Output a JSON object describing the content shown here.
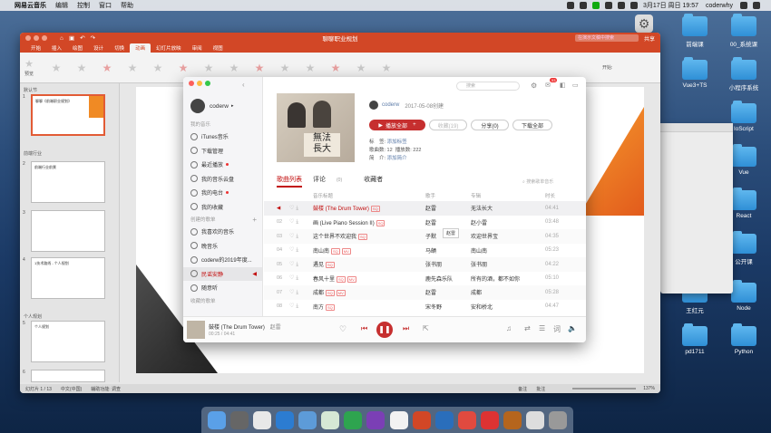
{
  "menubar": {
    "app": "网易云音乐",
    "items": [
      "编辑",
      "控制",
      "窗口",
      "帮助"
    ],
    "clock": "3月17日 周日 19:57",
    "user": "coderwhy"
  },
  "desktop_icons": [
    {
      "label": "前端课",
      "col": 0,
      "row": 0
    },
    {
      "label": "00_系统课",
      "col": 1,
      "row": 0
    },
    {
      "label": "Vue3+TS",
      "col": 0,
      "row": 1
    },
    {
      "label": "小程序系统",
      "col": 1,
      "row": 1
    },
    {
      "label": "loScript",
      "col": 1,
      "row": 2
    },
    {
      "label": "Vue",
      "col": 1,
      "row": 3
    },
    {
      "label": "React",
      "col": 1,
      "row": 4
    },
    {
      "label": "公开课",
      "col": 1,
      "row": 5
    },
    {
      "label": "Node",
      "col": 1,
      "row": 6
    },
    {
      "label": "Python",
      "col": 1,
      "row": 7
    },
    {
      "label": "王红元",
      "col": 0,
      "row": 6
    },
    {
      "label": "pd1711",
      "col": 0,
      "row": 7
    }
  ],
  "ppt": {
    "doc_title": "聊聊职业规划",
    "search_placeholder": "在演示文稿中搜索",
    "share_label": "共享",
    "tabs": [
      "开始",
      "插入",
      "绘图",
      "设计",
      "切换",
      "动画",
      "幻灯片放映",
      "审阅",
      "视图"
    ],
    "active_tab": "动画",
    "ribbon_preview": "预览",
    "ribbon_start": "开始:",
    "sections": [
      "默认节",
      "前端行业",
      "个人规划"
    ],
    "slides": [
      {
        "num": "1",
        "title": "聊聊《前端职业规划》"
      },
      {
        "num": "2",
        "title": "前端行业前景"
      },
      {
        "num": "3",
        "title": ""
      },
      {
        "num": "4",
        "title": "1技术路线 - 个人规划"
      },
      {
        "num": "5",
        "title": "个人规划"
      },
      {
        "num": "6",
        "title": ""
      }
    ],
    "status_slide": "幻灯片 1 / 13",
    "status_lang": "中文(中国)",
    "status_access": "辅助功能: 调查",
    "status_notes": "备注",
    "status_comments": "批注",
    "zoom": "137%"
  },
  "music": {
    "search_placeholder": "搜索",
    "badge_count": "53",
    "user": "coderw",
    "sidebar": {
      "section_mine": "我的音乐",
      "items": [
        "iTunes音乐",
        "下载管理",
        "最近播放",
        "我的音乐云盘",
        "我的电台",
        "我的收藏"
      ],
      "section_created": "创建的歌单",
      "playlists": [
        "我喜欢的音乐",
        "晚音乐",
        "coderw的2019年度...",
        "民谣安静",
        "随意听"
      ],
      "section_collected": "收藏的歌单"
    },
    "playlist": {
      "creator": "coderw",
      "created": "2017-05-08创建",
      "play_all": "播放全部",
      "collect": "收藏(19)",
      "share": "分享(0)",
      "download_all": "下载全部",
      "tag_label": "标　签:",
      "tag_value": "添加标签",
      "song_count_label": "歌曲数: 12",
      "play_count_label": "播放数: 222",
      "intro_label": "简　介:",
      "intro_value": "添加简介"
    },
    "tabs": {
      "songs": "歌曲列表",
      "comments": "评论",
      "comments_count": "(0)",
      "collectors": "收藏者"
    },
    "list_search_placeholder": "搜索歌单音乐",
    "headers": {
      "title": "音乐标题",
      "artist": "歌手",
      "album": "专辑",
      "time": "时长"
    },
    "songs": [
      {
        "num": "01",
        "title": "鼓楼 (The Drum Tower)",
        "artist": "赵雷",
        "album": "无法长大",
        "time": "04:41",
        "tags": [
          "SQ"
        ]
      },
      {
        "num": "02",
        "title": "画 (Live Piano Session II)",
        "artist": "赵雷",
        "album": "赵小雷",
        "time": "03:48",
        "tags": [
          "SQ"
        ]
      },
      {
        "num": "03",
        "title": "这个世界不欢迎我",
        "artist": "子默",
        "album": "欢迎世界宝",
        "time": "04:35",
        "tags": [
          "SQ"
        ]
      },
      {
        "num": "04",
        "title": "南山南",
        "artist": "马頔",
        "album": "南山南",
        "time": "05:23",
        "tags": [
          "SQ",
          "MV"
        ]
      },
      {
        "num": "05",
        "title": "遇见",
        "artist": "张书朋",
        "album": "张书朋",
        "time": "04:22",
        "tags": [
          "SQ"
        ]
      },
      {
        "num": "06",
        "title": "春风十里",
        "artist": "鹿先森乐队",
        "album": "所有的酒，都不如你",
        "time": "05:10",
        "tags": [
          "SQ",
          "MV"
        ]
      },
      {
        "num": "07",
        "title": "成都",
        "artist": "赵雷",
        "album": "成都",
        "time": "05:28",
        "tags": [
          "SQ",
          "MV"
        ]
      },
      {
        "num": "08",
        "title": "南方",
        "artist": "宋冬野",
        "album": "安和桥北",
        "time": "04:47",
        "tags": [
          "SQ"
        ]
      }
    ],
    "hover_popup": "赵雷",
    "now_playing": {
      "title": "鼓楼 (The Drum Tower)",
      "artist": "赵雷",
      "elapsed": "00:25",
      "total": "04:41"
    }
  }
}
